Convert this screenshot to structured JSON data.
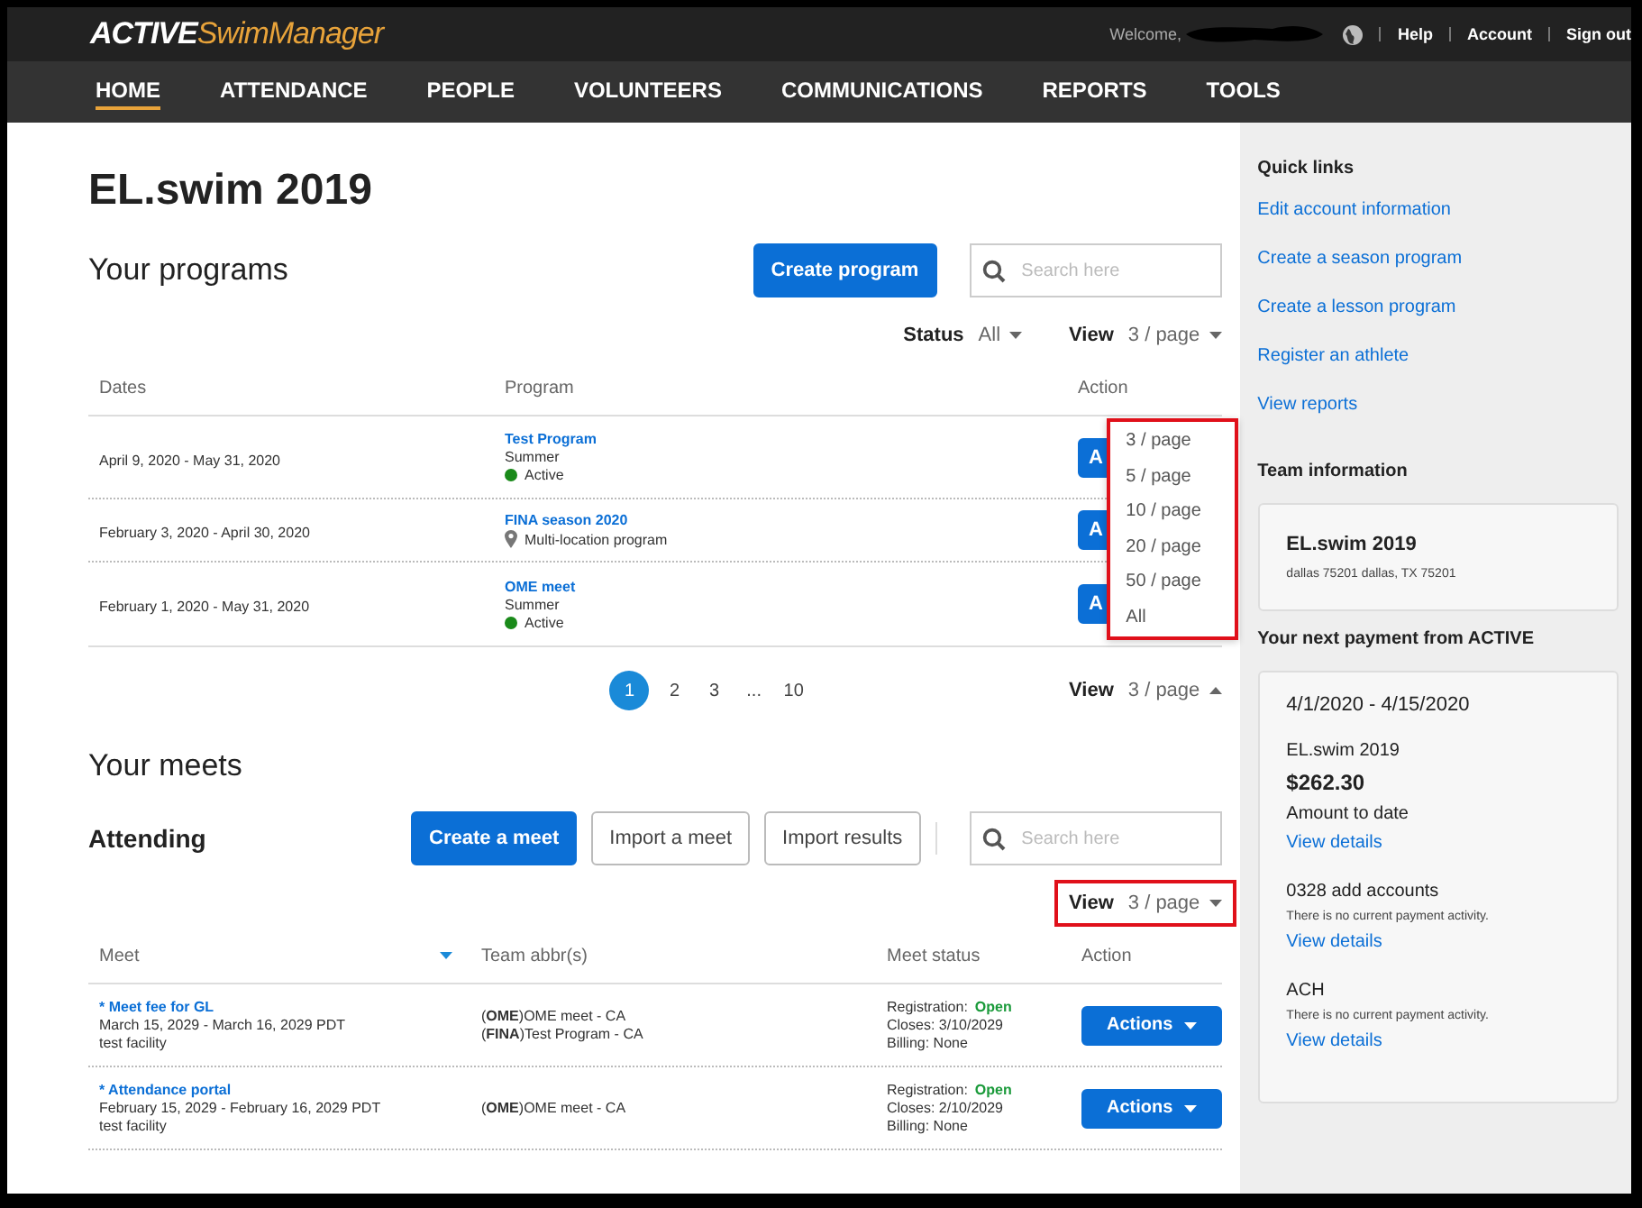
{
  "header": {
    "logo": {
      "brand": "ACTIVE",
      "product": "SwimManager"
    },
    "welcome": "Welcome,",
    "links": [
      "Help",
      "Account",
      "Sign out"
    ]
  },
  "nav": [
    {
      "label": "HOME",
      "selected": true
    },
    {
      "label": "ATTENDANCE",
      "selected": false
    },
    {
      "label": "PEOPLE",
      "selected": false
    },
    {
      "label": "VOLUNTEERS",
      "selected": false
    },
    {
      "label": "COMMUNICATIONS",
      "selected": false
    },
    {
      "label": "REPORTS",
      "selected": false
    },
    {
      "label": "TOOLS",
      "selected": false
    }
  ],
  "page_title": "EL.swim 2019",
  "programs": {
    "title": "Your programs",
    "create_button": "Create program",
    "search_placeholder": "Search here",
    "status_label": "Status",
    "status_value": "All",
    "view_label": "View",
    "view_value": "3 / page",
    "columns": [
      "Dates",
      "Program",
      "Action"
    ],
    "rows": [
      {
        "dates": "April 9, 2020 - May 31, 2020",
        "name": "Test Program",
        "season": "Summer",
        "status": {
          "label": "Active",
          "color": "#1a8a1a"
        },
        "action": "A"
      },
      {
        "dates": "February 3, 2020 - April 30, 2020",
        "name": "FINA season 2020",
        "location": "Multi-location program",
        "action": "A"
      },
      {
        "dates": "February 1, 2020 - May 31, 2020",
        "name": "OME meet",
        "season": "Summer",
        "status": {
          "label": "Active",
          "color": "#1a8a1a"
        },
        "action": "A"
      }
    ],
    "view_menu": {
      "highlighted": true,
      "items": [
        "3 / page",
        "5 / page",
        "10 / page",
        "20 / page",
        "50 / page",
        "All"
      ]
    },
    "pagination": {
      "pages": [
        {
          "label": "1",
          "selected": true
        },
        {
          "label": "2",
          "selected": false
        },
        {
          "label": "3",
          "selected": false
        },
        {
          "label": "...",
          "selected": false
        },
        {
          "label": "10",
          "selected": false
        }
      ],
      "view_label": "View",
      "view_value": "3 / page",
      "expanded": true
    }
  },
  "meets": {
    "title": "Your meets",
    "subtitle": "Attending",
    "buttons": [
      {
        "label": "Create a meet",
        "kind": "primary"
      },
      {
        "label": "Import a meet",
        "kind": "secondary"
      },
      {
        "label": "Import results",
        "kind": "secondary"
      }
    ],
    "search_placeholder": "Search here",
    "view_label": "View",
    "view_value": "3 / page",
    "view_highlighted": true,
    "columns": [
      {
        "label": "Meet",
        "sort_icon": true
      },
      {
        "label": "Team abbr(s)"
      },
      {
        "label": "Meet status"
      },
      {
        "label": "Action"
      }
    ],
    "rows": [
      {
        "name": "* Meet fee for GL",
        "dates": "March 15, 2029 - March 16, 2029 PDT",
        "facility": "test facility",
        "teams": [
          "(**OME**)OME meet - CA",
          "(**FINA**)Test Program - CA"
        ],
        "registration_label": "Registration:",
        "registration_value": "Open",
        "closes": "Closes: 3/10/2029",
        "billing": "Billing: None",
        "action": "Actions"
      },
      {
        "name": "* Attendance portal",
        "dates": "February 15, 2029 - February 16, 2029 PDT",
        "facility": "test facility",
        "teams": [
          "(**OME**)OME meet - CA"
        ],
        "registration_label": "Registration:",
        "registration_value": "Open",
        "closes": "Closes: 2/10/2029",
        "billing": "Billing: None",
        "action": "Actions"
      }
    ]
  },
  "sidebar": {
    "quick_links_title": "Quick links",
    "quick_links": [
      "Edit account information",
      "Create a season program",
      "Create a lesson program",
      "Register an athlete",
      "View reports"
    ],
    "team_title": "Team information",
    "team": {
      "name": "EL.swim 2019",
      "address": "dallas 75201 dallas, TX 75201"
    },
    "payment_title": "Your next payment from ACTIVE",
    "payment": {
      "period": "4/1/2020 - 4/15/2020",
      "entries": [
        {
          "name": "EL.swim 2019",
          "amount": "$262.30",
          "amount_label": "Amount to date",
          "link": "View details"
        },
        {
          "name": "0328 add accounts",
          "note": "There is no current payment activity.",
          "link": "View details"
        },
        {
          "name": "ACH",
          "note": "There is no current payment activity.",
          "link": "View details"
        }
      ]
    }
  }
}
